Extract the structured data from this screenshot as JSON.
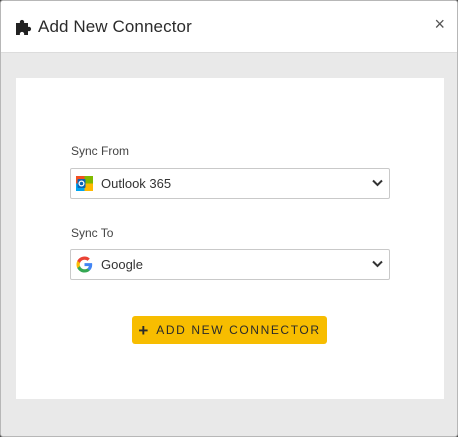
{
  "modal": {
    "title": "Add New Connector",
    "close_glyph": "×",
    "header_icon": "puzzle-icon"
  },
  "form": {
    "sync_from": {
      "label": "Sync From",
      "value": "Outlook 365",
      "icon": "outlook-icon"
    },
    "sync_to": {
      "label": "Sync To",
      "value": "Google",
      "icon": "google-icon"
    },
    "submit": {
      "label": "ADD NEW CONNECTOR",
      "icon_glyph": "+"
    }
  },
  "colors": {
    "accent": "#f7bd00",
    "backdrop": "#e9e9e9"
  }
}
